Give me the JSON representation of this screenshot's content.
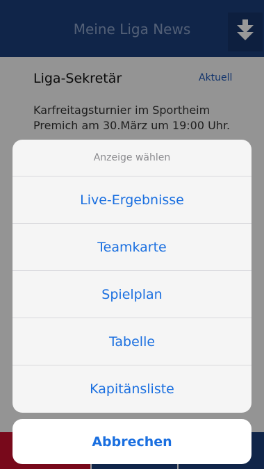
{
  "navbar": {
    "title": "Meine Liga News",
    "download_icon": "download-arrow-icon"
  },
  "news": {
    "title": "Liga-Sekretär",
    "tag": "Aktuell",
    "text": "Karfreitagsturnier im Sportheim Premich am 30.März um 19:00 Uhr."
  },
  "action_sheet": {
    "header": "Anzeige wählen",
    "options": [
      {
        "label": "Live-Ergebnisse"
      },
      {
        "label": "Teamkarte"
      },
      {
        "label": "Spielplan"
      },
      {
        "label": "Tabelle"
      },
      {
        "label": "Kapitänsliste"
      }
    ],
    "cancel_label": "Abbrechen"
  },
  "colors": {
    "navbar_bg": "#1c3f7b",
    "accent_blue": "#1a6fe0",
    "bottom_red": "#c8102e"
  }
}
